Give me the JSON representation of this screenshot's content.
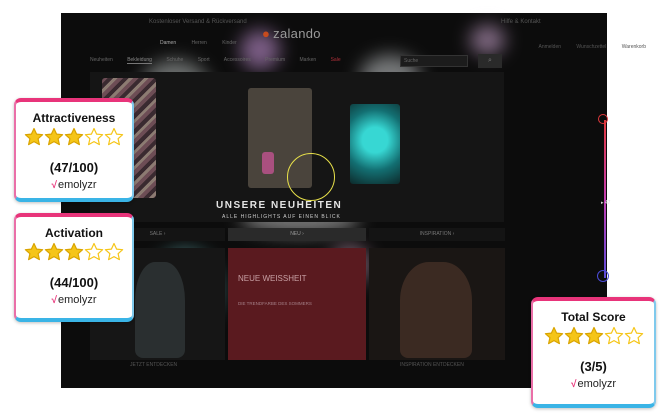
{
  "shop": {
    "logo": "zalando",
    "topbar_left": "Kostenloser Versand & Rückversand",
    "topbar_right": "Hilfe & Kontakt",
    "nav_items": [
      "Damen",
      "Herren",
      "Kinder"
    ],
    "categories": [
      "Neuheiten",
      "Bekleidung",
      "Schuhe",
      "Sport",
      "Accessoires",
      "Premium",
      "Marken",
      "Sale"
    ],
    "nav_icons": [
      "Anmelden",
      "Wunschzettel",
      "Warenkorb"
    ],
    "search_placeholder": "Suche",
    "hero_title": "UNSERE NEUHEITEN",
    "hero_subtitle": "ALLE HIGHLIGHTS AUF EINEN BLICK",
    "tabs": [
      "SALE ›",
      "NEU ›",
      "INSPIRATION ›"
    ],
    "card_title": "NEUE WEISSHEIT",
    "card_sub": "DIE TRENDFARBE DES SOMMERS",
    "footer_left": "JETZT ENTDECKEN",
    "footer_right": "INSPIRATION ENTDECKEN",
    "slider_value": "47"
  },
  "attractiveness": {
    "title": "Attractiveness",
    "score": "(47/100)",
    "stars": 3,
    "brand": "emolyzr"
  },
  "activation": {
    "title": "Activation",
    "score": "(44/100)",
    "stars": 3,
    "brand": "emolyzr"
  },
  "total": {
    "title": "Total Score",
    "score": "(3/5)",
    "stars": 3,
    "brand": "emolyzr"
  },
  "colors": {
    "accent_pink": "#e8347a",
    "accent_blue": "#3ab4e6",
    "star_gold": "#f5c518",
    "gaze_yellow": "#e8e14a",
    "zalando_orange": "#c64b1e"
  }
}
